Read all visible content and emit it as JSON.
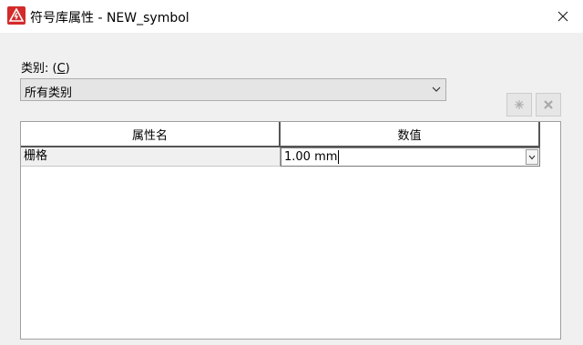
{
  "window": {
    "title": "符号库属性 - NEW_symbol",
    "icon": "app-logo-icon",
    "close_icon": "close-icon"
  },
  "category": {
    "label_prefix": "类别: (",
    "label_key": "C",
    "label_suffix": ")",
    "selected": "所有类别"
  },
  "toolbar": {
    "add_icon": "add-icon",
    "delete_icon": "delete-icon"
  },
  "grid": {
    "columns": [
      "属性名",
      "数值"
    ],
    "rows": [
      {
        "name": "栅格",
        "value": "1.00 mm"
      }
    ]
  },
  "colors": {
    "accent": "#d32a2a"
  }
}
